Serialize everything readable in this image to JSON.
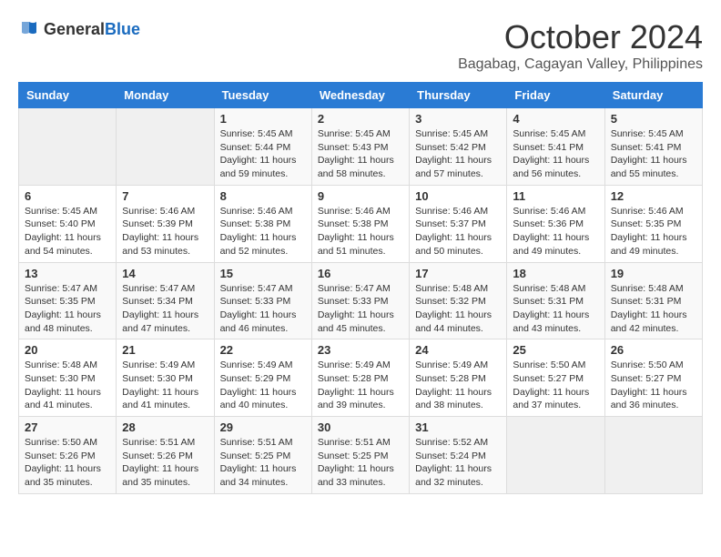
{
  "header": {
    "logo": {
      "general": "General",
      "blue": "Blue"
    },
    "month": "October 2024",
    "location": "Bagabag, Cagayan Valley, Philippines"
  },
  "weekdays": [
    "Sunday",
    "Monday",
    "Tuesday",
    "Wednesday",
    "Thursday",
    "Friday",
    "Saturday"
  ],
  "weeks": [
    [
      {
        "day": "",
        "sunrise": "",
        "sunset": "",
        "daylight": ""
      },
      {
        "day": "",
        "sunrise": "",
        "sunset": "",
        "daylight": ""
      },
      {
        "day": "1",
        "sunrise": "Sunrise: 5:45 AM",
        "sunset": "Sunset: 5:44 PM",
        "daylight": "Daylight: 11 hours and 59 minutes."
      },
      {
        "day": "2",
        "sunrise": "Sunrise: 5:45 AM",
        "sunset": "Sunset: 5:43 PM",
        "daylight": "Daylight: 11 hours and 58 minutes."
      },
      {
        "day": "3",
        "sunrise": "Sunrise: 5:45 AM",
        "sunset": "Sunset: 5:42 PM",
        "daylight": "Daylight: 11 hours and 57 minutes."
      },
      {
        "day": "4",
        "sunrise": "Sunrise: 5:45 AM",
        "sunset": "Sunset: 5:41 PM",
        "daylight": "Daylight: 11 hours and 56 minutes."
      },
      {
        "day": "5",
        "sunrise": "Sunrise: 5:45 AM",
        "sunset": "Sunset: 5:41 PM",
        "daylight": "Daylight: 11 hours and 55 minutes."
      }
    ],
    [
      {
        "day": "6",
        "sunrise": "Sunrise: 5:45 AM",
        "sunset": "Sunset: 5:40 PM",
        "daylight": "Daylight: 11 hours and 54 minutes."
      },
      {
        "day": "7",
        "sunrise": "Sunrise: 5:46 AM",
        "sunset": "Sunset: 5:39 PM",
        "daylight": "Daylight: 11 hours and 53 minutes."
      },
      {
        "day": "8",
        "sunrise": "Sunrise: 5:46 AM",
        "sunset": "Sunset: 5:38 PM",
        "daylight": "Daylight: 11 hours and 52 minutes."
      },
      {
        "day": "9",
        "sunrise": "Sunrise: 5:46 AM",
        "sunset": "Sunset: 5:38 PM",
        "daylight": "Daylight: 11 hours and 51 minutes."
      },
      {
        "day": "10",
        "sunrise": "Sunrise: 5:46 AM",
        "sunset": "Sunset: 5:37 PM",
        "daylight": "Daylight: 11 hours and 50 minutes."
      },
      {
        "day": "11",
        "sunrise": "Sunrise: 5:46 AM",
        "sunset": "Sunset: 5:36 PM",
        "daylight": "Daylight: 11 hours and 49 minutes."
      },
      {
        "day": "12",
        "sunrise": "Sunrise: 5:46 AM",
        "sunset": "Sunset: 5:35 PM",
        "daylight": "Daylight: 11 hours and 49 minutes."
      }
    ],
    [
      {
        "day": "13",
        "sunrise": "Sunrise: 5:47 AM",
        "sunset": "Sunset: 5:35 PM",
        "daylight": "Daylight: 11 hours and 48 minutes."
      },
      {
        "day": "14",
        "sunrise": "Sunrise: 5:47 AM",
        "sunset": "Sunset: 5:34 PM",
        "daylight": "Daylight: 11 hours and 47 minutes."
      },
      {
        "day": "15",
        "sunrise": "Sunrise: 5:47 AM",
        "sunset": "Sunset: 5:33 PM",
        "daylight": "Daylight: 11 hours and 46 minutes."
      },
      {
        "day": "16",
        "sunrise": "Sunrise: 5:47 AM",
        "sunset": "Sunset: 5:33 PM",
        "daylight": "Daylight: 11 hours and 45 minutes."
      },
      {
        "day": "17",
        "sunrise": "Sunrise: 5:48 AM",
        "sunset": "Sunset: 5:32 PM",
        "daylight": "Daylight: 11 hours and 44 minutes."
      },
      {
        "day": "18",
        "sunrise": "Sunrise: 5:48 AM",
        "sunset": "Sunset: 5:31 PM",
        "daylight": "Daylight: 11 hours and 43 minutes."
      },
      {
        "day": "19",
        "sunrise": "Sunrise: 5:48 AM",
        "sunset": "Sunset: 5:31 PM",
        "daylight": "Daylight: 11 hours and 42 minutes."
      }
    ],
    [
      {
        "day": "20",
        "sunrise": "Sunrise: 5:48 AM",
        "sunset": "Sunset: 5:30 PM",
        "daylight": "Daylight: 11 hours and 41 minutes."
      },
      {
        "day": "21",
        "sunrise": "Sunrise: 5:49 AM",
        "sunset": "Sunset: 5:30 PM",
        "daylight": "Daylight: 11 hours and 41 minutes."
      },
      {
        "day": "22",
        "sunrise": "Sunrise: 5:49 AM",
        "sunset": "Sunset: 5:29 PM",
        "daylight": "Daylight: 11 hours and 40 minutes."
      },
      {
        "day": "23",
        "sunrise": "Sunrise: 5:49 AM",
        "sunset": "Sunset: 5:28 PM",
        "daylight": "Daylight: 11 hours and 39 minutes."
      },
      {
        "day": "24",
        "sunrise": "Sunrise: 5:49 AM",
        "sunset": "Sunset: 5:28 PM",
        "daylight": "Daylight: 11 hours and 38 minutes."
      },
      {
        "day": "25",
        "sunrise": "Sunrise: 5:50 AM",
        "sunset": "Sunset: 5:27 PM",
        "daylight": "Daylight: 11 hours and 37 minutes."
      },
      {
        "day": "26",
        "sunrise": "Sunrise: 5:50 AM",
        "sunset": "Sunset: 5:27 PM",
        "daylight": "Daylight: 11 hours and 36 minutes."
      }
    ],
    [
      {
        "day": "27",
        "sunrise": "Sunrise: 5:50 AM",
        "sunset": "Sunset: 5:26 PM",
        "daylight": "Daylight: 11 hours and 35 minutes."
      },
      {
        "day": "28",
        "sunrise": "Sunrise: 5:51 AM",
        "sunset": "Sunset: 5:26 PM",
        "daylight": "Daylight: 11 hours and 35 minutes."
      },
      {
        "day": "29",
        "sunrise": "Sunrise: 5:51 AM",
        "sunset": "Sunset: 5:25 PM",
        "daylight": "Daylight: 11 hours and 34 minutes."
      },
      {
        "day": "30",
        "sunrise": "Sunrise: 5:51 AM",
        "sunset": "Sunset: 5:25 PM",
        "daylight": "Daylight: 11 hours and 33 minutes."
      },
      {
        "day": "31",
        "sunrise": "Sunrise: 5:52 AM",
        "sunset": "Sunset: 5:24 PM",
        "daylight": "Daylight: 11 hours and 32 minutes."
      },
      {
        "day": "",
        "sunrise": "",
        "sunset": "",
        "daylight": ""
      },
      {
        "day": "",
        "sunrise": "",
        "sunset": "",
        "daylight": ""
      }
    ]
  ]
}
